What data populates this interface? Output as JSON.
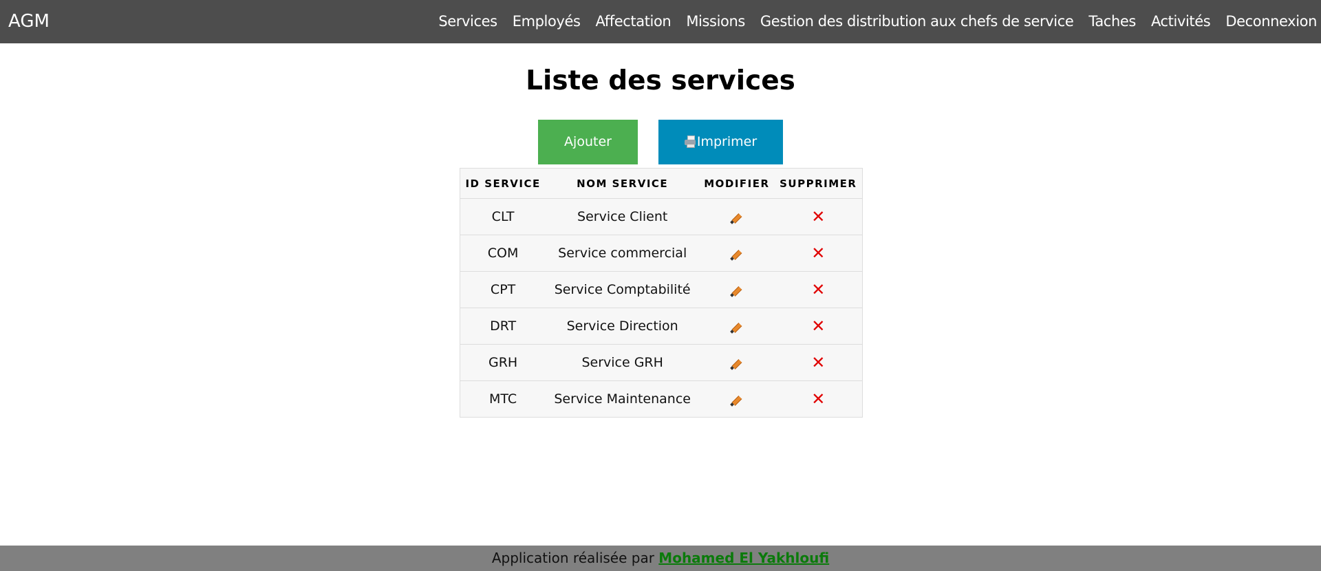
{
  "brand": "AGM",
  "nav": [
    "Services",
    "Employés",
    "Affectation",
    "Missions",
    "Gestion des distribution aux chefs de service",
    "Taches",
    "Activités",
    "Deconnexion"
  ],
  "page_title": "Liste des services",
  "buttons": {
    "add": "Ajouter",
    "print": "Imprimer",
    "print_icon": "printer-icon"
  },
  "table": {
    "headers": [
      "ID SERVICE",
      "NOM SERVICE",
      "MODIFIER",
      "SUPPRIMER"
    ],
    "rows": [
      {
        "id": "CLT",
        "name": "Service Client"
      },
      {
        "id": "COM",
        "name": "Service commercial"
      },
      {
        "id": "CPT",
        "name": "Service Comptabilité"
      },
      {
        "id": "DRT",
        "name": "Service Direction"
      },
      {
        "id": "GRH",
        "name": "Service GRH"
      },
      {
        "id": "MTC",
        "name": "Service Maintenance"
      }
    ],
    "edit_icon": "pencil-icon",
    "delete_icon": "cross-icon",
    "delete_glyph": "✕"
  },
  "footer": {
    "text": "Application réalisée par ",
    "author": "Mohamed El Yakhloufi"
  },
  "colors": {
    "topbar": "#4d4d4d",
    "add_button": "#4caf50",
    "print_button": "#008cba",
    "delete": "#e00000",
    "footer": "#808080",
    "footer_link": "#0b7a0b"
  }
}
